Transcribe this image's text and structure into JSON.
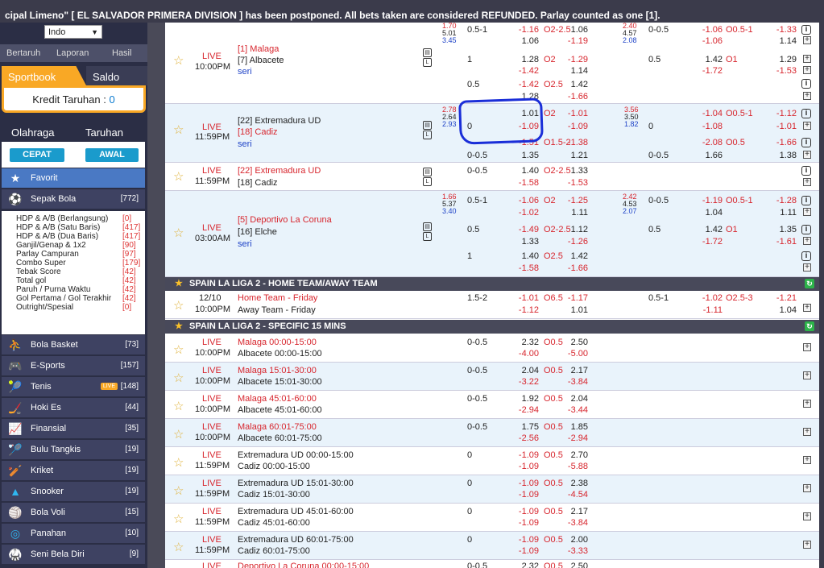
{
  "ticker": "cipal Limeno\" [ EL SALVADOR PRIMERA DIVISION ] has been postponed. All bets taken are considered REFUNDED. Parlay counted as one [1].",
  "sidebar": {
    "odds_select": "Indo",
    "links": [
      "Bertaruh",
      "Laporan",
      "Hasil"
    ],
    "tabs": [
      "Sportbook",
      "Saldo"
    ],
    "kredit_label": "Kredit Taruhan : ",
    "kredit_value": "0",
    "sport_tabs": [
      "Olahraga",
      "Taruhan"
    ],
    "quick_buttons": [
      "CEPAT",
      "AWAL"
    ],
    "favorit": "Favorit",
    "sepak_bola": {
      "label": "Sepak Bola",
      "count": "[772]"
    },
    "sub_items": [
      {
        "label": "HDP & A/B (Berlangsung)",
        "count": "[0]"
      },
      {
        "label": "HDP & A/B (Satu Baris)",
        "count": "[417]"
      },
      {
        "label": "HDP & A/B (Dua Baris)",
        "count": "[417]"
      },
      {
        "label": "Ganjil/Genap & 1x2",
        "count": "[90]"
      },
      {
        "label": "Parlay Campuran",
        "count": "[97]"
      },
      {
        "label": "Combo Super",
        "count": "[179]"
      },
      {
        "label": "Tebak Score",
        "count": "[42]"
      },
      {
        "label": "Total gol",
        "count": "[42]"
      },
      {
        "label": "Paruh / Purna Waktu",
        "count": "[42]"
      },
      {
        "label": "Gol Pertama / Gol Terakhir",
        "count": "[42]"
      },
      {
        "label": "Outright/Spesial",
        "count": "[0]"
      }
    ],
    "sports": [
      {
        "label": "Bola Basket",
        "count": "[73]",
        "icon": "basketball-icon"
      },
      {
        "label": "E-Sports",
        "count": "[157]",
        "icon": "gamepad-icon"
      },
      {
        "label": "Tenis",
        "count": "[148]",
        "icon": "tennis-icon",
        "badge": "LIVE"
      },
      {
        "label": "Hoki Es",
        "count": "[44]",
        "icon": "hockey-icon"
      },
      {
        "label": "Finansial",
        "count": "[35]",
        "icon": "chart-icon"
      },
      {
        "label": "Bulu Tangkis",
        "count": "[19]",
        "icon": "badminton-icon"
      },
      {
        "label": "Kriket",
        "count": "[19]",
        "icon": "cricket-icon"
      },
      {
        "label": "Snooker",
        "count": "[19]",
        "icon": "snooker-icon"
      },
      {
        "label": "Bola Voli",
        "count": "[15]",
        "icon": "volleyball-icon"
      },
      {
        "label": "Panahan",
        "count": "[10]",
        "icon": "archery-icon"
      },
      {
        "label": "Seni Bela Diri",
        "count": "[9]",
        "icon": "martial-arts-icon"
      }
    ]
  },
  "leagues": [
    "SPAIN LA LIGA 2 - HOME TEAM/AWAY TEAM",
    "SPAIN LA LIGA 2 - SPECIFIC 15 MINS"
  ],
  "match1": {
    "live": "LIVE",
    "time": "10:00PM",
    "home": "[1] Malaga",
    "away": "[7] Albacete",
    "draw": "seri",
    "x12": [
      "1.70",
      "5.01",
      "3.45"
    ],
    "lines": [
      [
        "0.5-1",
        "-1.16",
        "O2-2.5",
        "1.06",
        "0-0.5",
        "-1.06",
        "O0.5-1",
        "-1.33"
      ],
      [
        "",
        "1.06",
        "",
        "-1.19",
        "",
        "-1.06",
        "",
        "1.14"
      ],
      [
        "1",
        "1.28",
        "O2",
        "-1.29",
        "0.5",
        "1.42",
        "O1",
        "1.29"
      ],
      [
        "",
        "-1.42",
        "",
        "1.14",
        "",
        "-1.72",
        "",
        "-1.53"
      ],
      [
        "0.5",
        "-1.42",
        "O2.5",
        "1.42"
      ],
      [
        "",
        "1.28",
        "",
        "-1.66"
      ]
    ],
    "h1x2": [
      "2.40",
      "4.57",
      "2.08"
    ]
  },
  "match2": {
    "live": "LIVE",
    "time": "11:59PM",
    "home": "[22] Extremadura UD",
    "away": "[18] Cadiz",
    "draw": "seri",
    "x12": [
      "2.78",
      "2.64",
      "2.93"
    ],
    "h1x2": [
      "3.56",
      "3.50",
      "1.82"
    ],
    "lines": [
      [
        "",
        "1.01",
        "O2",
        "-1.01",
        "",
        "-1.04",
        "O0.5-1",
        "-1.12"
      ],
      [
        "0",
        "-1.09",
        "",
        "-1.09",
        "0",
        "-1.08",
        "",
        "-1.01"
      ],
      [
        "",
        "-1.51",
        "O1.5-2",
        "-1.38",
        "",
        "-2.08",
        "O0.5",
        "-1.66"
      ],
      [
        "0-0.5",
        "1.35",
        "",
        "1.21",
        "0-0.5",
        "1.66",
        "",
        "1.38"
      ]
    ]
  },
  "match3": {
    "live": "LIVE",
    "time": "11:59PM",
    "home": "[22] Extremadura UD",
    "away": "[18] Cadiz",
    "line": [
      "0-0.5",
      "1.40",
      "O2-2.5",
      "1.33"
    ],
    "line2": [
      "",
      "-1.58",
      "",
      "-1.53"
    ]
  },
  "match4": {
    "live": "LIVE",
    "time": "03:00AM",
    "home": "[5] Deportivo La Coruna",
    "away": "[16] Elche",
    "draw": "seri",
    "x12": [
      "1.66",
      "5.37",
      "3.40"
    ],
    "h1x2": [
      "2.42",
      "4.53",
      "2.07"
    ],
    "lines": [
      [
        "0.5-1",
        "-1.06",
        "O2",
        "-1.25",
        "0-0.5",
        "-1.19",
        "O0.5-1",
        "-1.28"
      ],
      [
        "",
        "-1.02",
        "",
        "1.11",
        "",
        "1.04",
        "",
        "1.11"
      ],
      [
        "0.5",
        "-1.49",
        "O2-2.5",
        "1.12",
        "0.5",
        "1.42",
        "O1",
        "1.35"
      ],
      [
        "",
        "1.33",
        "",
        "-1.26",
        "",
        "-1.72",
        "",
        "-1.61"
      ],
      [
        "1",
        "1.40",
        "O2.5",
        "1.42"
      ],
      [
        "",
        "-1.58",
        "",
        "-1.66"
      ]
    ]
  },
  "match5": {
    "date": "12/10",
    "time": "10:00PM",
    "home": "Home Team - Friday",
    "away": "Away Team - Friday",
    "line": [
      "1.5-2",
      "-1.01",
      "O6.5",
      "-1.17",
      "0.5-1",
      "-1.02",
      "O2.5-3",
      "-1.21"
    ],
    "line2": [
      "",
      "-1.12",
      "",
      "1.01",
      "",
      "-1.11",
      "",
      "1.04"
    ]
  },
  "mins": [
    {
      "time": "10:00PM",
      "home": "Malaga 00:00-15:00",
      "away": "Albacete 00:00-15:00",
      "hdp": "0-0.5",
      "o1": "2.32",
      "ou": "O0.5",
      "o2": "2.50",
      "u1": "-4.00",
      "u2": "-5.00",
      "homeRed": true
    },
    {
      "time": "10:00PM",
      "home": "Malaga 15:01-30:00",
      "away": "Albacete 15:01-30:00",
      "hdp": "0-0.5",
      "o1": "2.04",
      "ou": "O0.5",
      "o2": "2.17",
      "u1": "-3.22",
      "u2": "-3.84",
      "homeRed": true
    },
    {
      "time": "10:00PM",
      "home": "Malaga 45:01-60:00",
      "away": "Albacete 45:01-60:00",
      "hdp": "0-0.5",
      "o1": "1.92",
      "ou": "O0.5",
      "o2": "2.04",
      "u1": "-2.94",
      "u2": "-3.44",
      "homeRed": true
    },
    {
      "time": "10:00PM",
      "home": "Malaga 60:01-75:00",
      "away": "Albacete 60:01-75:00",
      "hdp": "0-0.5",
      "o1": "1.75",
      "ou": "O0.5",
      "o2": "1.85",
      "u1": "-2.56",
      "u2": "-2.94",
      "homeRed": true
    },
    {
      "time": "11:59PM",
      "home": "Extremadura UD 00:00-15:00",
      "away": "Cadiz 00:00-15:00",
      "hdp": "0",
      "o1": "-1.09",
      "ou": "O0.5",
      "o2": "2.70",
      "u1": "-1.09",
      "u2": "-5.88",
      "homeRed": false
    },
    {
      "time": "11:59PM",
      "home": "Extremadura UD 15:01-30:00",
      "away": "Cadiz 15:01-30:00",
      "hdp": "0",
      "o1": "-1.09",
      "ou": "O0.5",
      "o2": "2.38",
      "u1": "-1.09",
      "u2": "-4.54",
      "homeRed": false
    },
    {
      "time": "11:59PM",
      "home": "Extremadura UD 45:01-60:00",
      "away": "Cadiz 45:01-60:00",
      "hdp": "0",
      "o1": "-1.09",
      "ou": "O0.5",
      "o2": "2.17",
      "u1": "-1.09",
      "u2": "-3.84",
      "homeRed": false
    },
    {
      "time": "11:59PM",
      "home": "Extremadura UD 60:01-75:00",
      "away": "Cadiz 60:01-75:00",
      "hdp": "0",
      "o1": "-1.09",
      "ou": "O0.5",
      "o2": "2.00",
      "u1": "-1.09",
      "u2": "-3.33",
      "homeRed": false
    }
  ],
  "live_label": "LIVE",
  "last_row": {
    "live": "LIVE",
    "home": "Deportivo La Coruna 00:00-15:00",
    "hdp": "0-0.5",
    "o1": "2.32",
    "ou": "O0.5",
    "o2": "2.50"
  }
}
